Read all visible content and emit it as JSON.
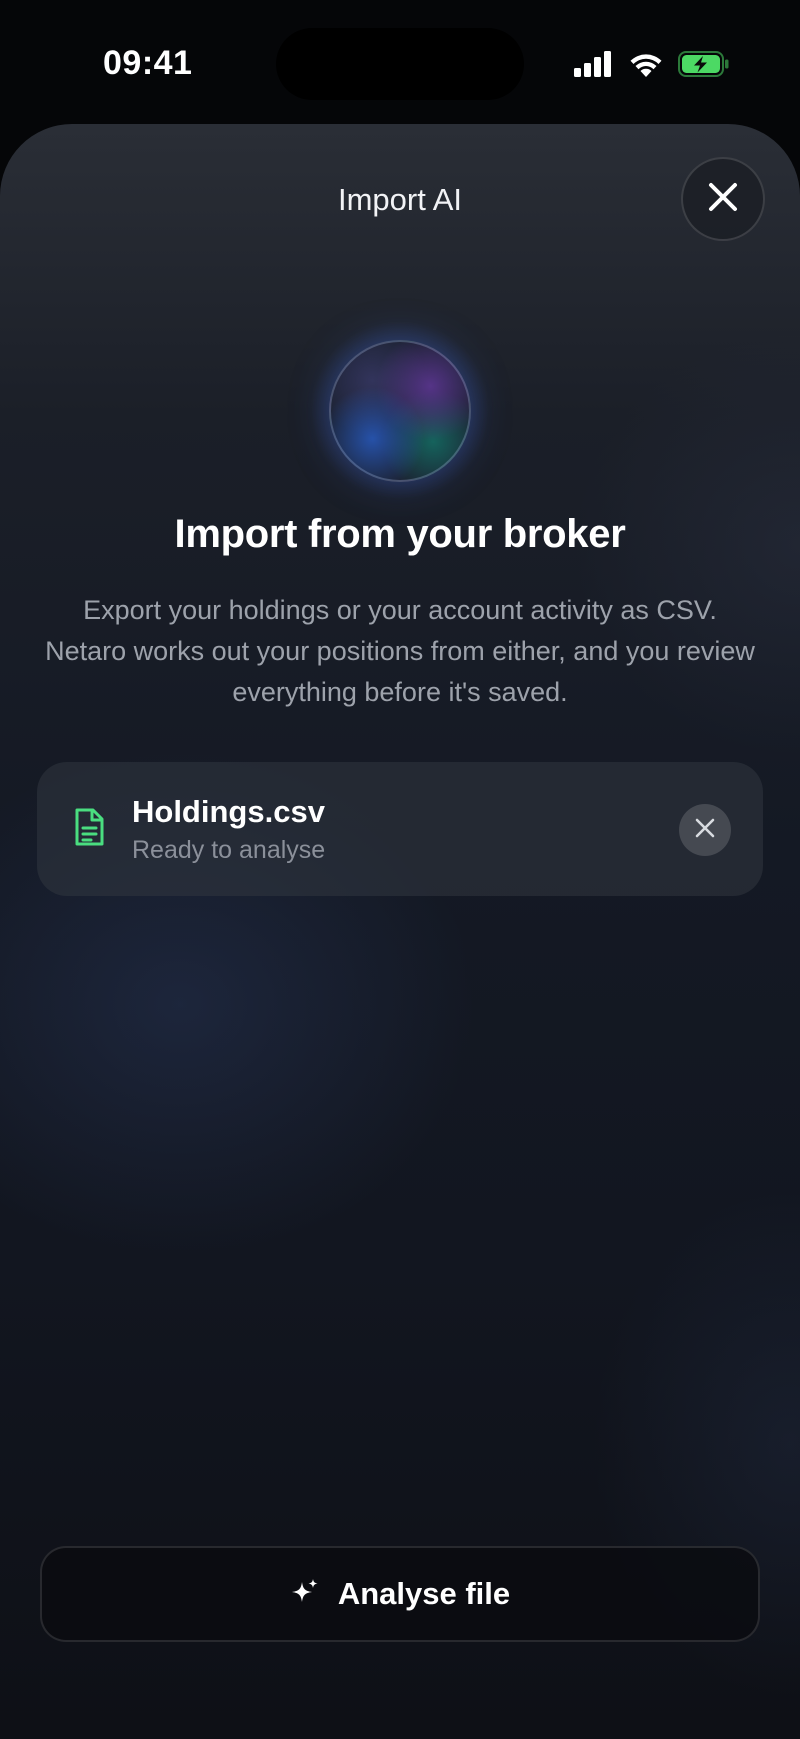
{
  "status_bar": {
    "time": "09:41",
    "icons": [
      "cellular-signal-icon",
      "wifi-icon",
      "battery-charging-icon"
    ],
    "battery_color": "#4cd964"
  },
  "sheet": {
    "title": "Import AI",
    "close_icon": "close-icon"
  },
  "hero": {
    "heading": "Import from your broker",
    "description": "Export your holdings or your account activity as CSV. Netaro works out your positions from either, and you review everything before it's saved."
  },
  "file": {
    "name": "Holdings.csv",
    "status": "Ready to analyse",
    "icon": "document-icon",
    "icon_color": "#4ade80",
    "remove_icon": "close-icon"
  },
  "actions": {
    "analyse_label": "Analyse file",
    "analyse_icon": "sparkles-icon"
  }
}
